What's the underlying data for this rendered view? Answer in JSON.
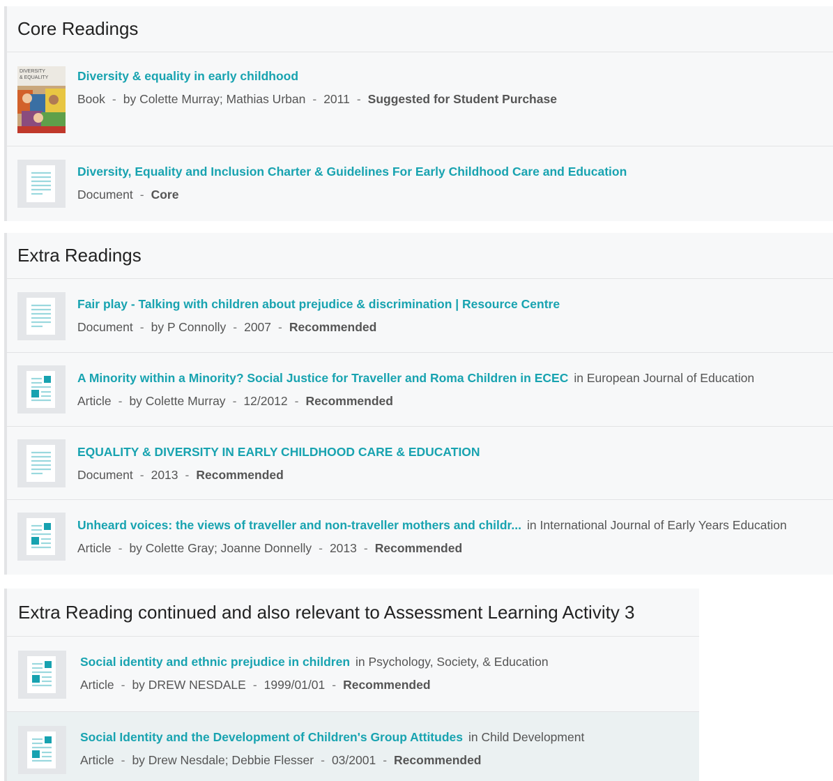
{
  "sections": [
    {
      "heading": "Core Readings",
      "items": [
        {
          "title": "Diversity & equality in early childhood",
          "type": "Book",
          "authors": "by Colette Murray; Mathias Urban",
          "date": "2011",
          "status": "Suggested for Student Purchase",
          "cover_text": [
            "DIVERSITY",
            "& EQUALITY"
          ]
        },
        {
          "title": "Diversity, Equality and Inclusion Charter & Guidelines For Early Childhood Care and Education",
          "type": "Document",
          "status": "Core"
        }
      ]
    },
    {
      "heading": "Extra Readings",
      "items": [
        {
          "title": "Fair play - Talking with children about prejudice & discrimination | Resource Centre",
          "type": "Document",
          "authors": "by P Connolly",
          "date": "2007",
          "status": "Recommended"
        },
        {
          "title": "A Minority within a Minority? Social Justice for Traveller and Roma Children in ECEC",
          "journal": "in European Journal of Education",
          "type": "Article",
          "authors": "by Colette Murray",
          "date": "12/2012",
          "status": "Recommended"
        },
        {
          "title": "EQUALITY & DIVERSITY IN EARLY CHILDHOOD CARE & EDUCATION",
          "type": "Document",
          "date": "2013",
          "status": "Recommended"
        },
        {
          "title": "Unheard voices: the views of traveller and non-traveller mothers and childr...",
          "journal": "in International Journal of Early Years Education",
          "type": "Article",
          "authors": "by Colette Gray; Joanne Donnelly",
          "date": "2013",
          "status": "Recommended"
        }
      ]
    },
    {
      "heading": "Extra Reading continued and also relevant to Assessment Learning Activity 3",
      "items": [
        {
          "title": "Social identity and ethnic prejudice in children",
          "journal": "in Psychology, Society, & Education",
          "type": "Article",
          "authors": "by DREW NESDALE",
          "date": "1999/01/01",
          "status": "Recommended"
        },
        {
          "title": "Social Identity and the Development of Children's Group Attitudes",
          "journal": "in Child Development",
          "type": "Article",
          "authors": "by Drew Nesdale; Debbie Flesser",
          "date": "03/2001",
          "status": "Recommended"
        }
      ]
    }
  ],
  "colors": {
    "link": "#18a3b0",
    "icon_teal": "#17a2b0",
    "icon_line": "#9ad8de",
    "highlight": "#ebf1f2"
  },
  "icons": {
    "document": "document-lines-icon",
    "article": "article-icon"
  }
}
